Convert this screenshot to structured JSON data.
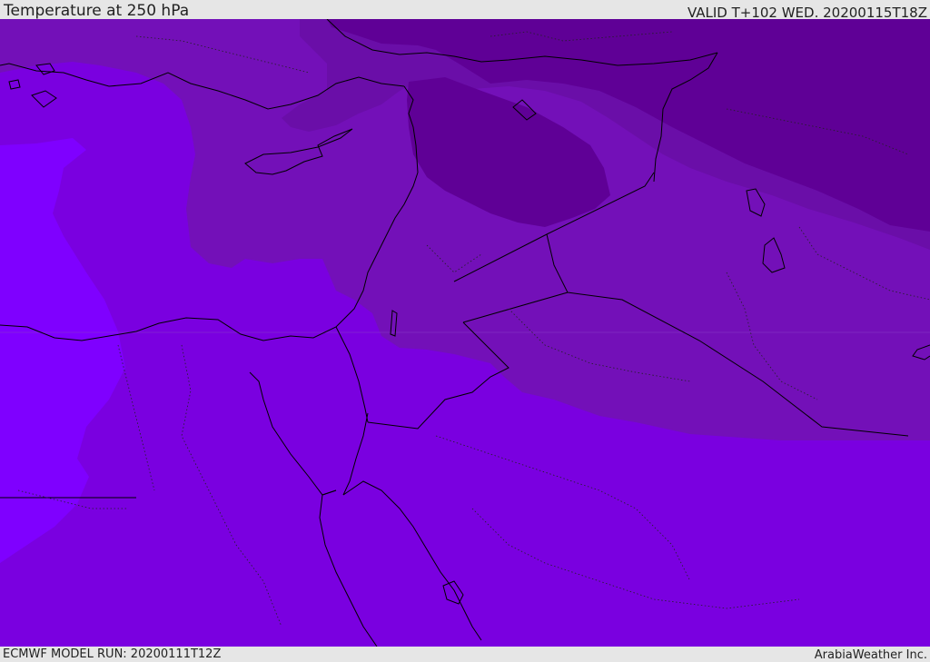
{
  "header": {
    "title": "Temperature at 250 hPa",
    "valid_time": "VALID T+102 WED. 20200115T18Z"
  },
  "footer": {
    "model_run": "ECMWF MODEL RUN: 20200111T12Z",
    "credit": "ArabiaWeather Inc."
  },
  "map": {
    "fill_colors": {
      "warmest": "#7f00ff",
      "warm": "#7a00e0",
      "mid": "#7310b8",
      "cool": "#6a0ea8",
      "coldest": "#5f0096"
    },
    "coastline_color": "#000000",
    "border_style": "solid",
    "admin_border_style": "dotted"
  }
}
